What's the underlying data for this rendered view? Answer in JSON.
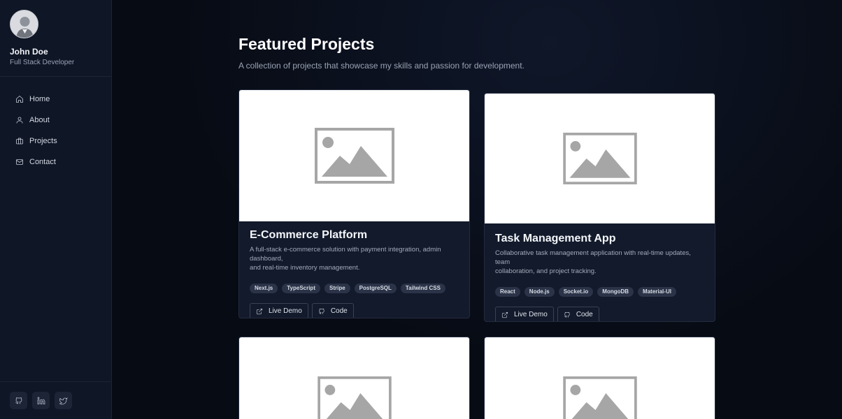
{
  "profile": {
    "name": "John Doe",
    "role": "Full Stack Developer"
  },
  "nav": [
    {
      "label": "Home",
      "icon": "home-icon"
    },
    {
      "label": "About",
      "icon": "user-icon"
    },
    {
      "label": "Projects",
      "icon": "briefcase-icon"
    },
    {
      "label": "Contact",
      "icon": "mail-icon"
    }
  ],
  "social": [
    "github-icon",
    "linkedin-icon",
    "twitter-icon"
  ],
  "main": {
    "title": "Featured Projects",
    "subtitle": "A collection of projects that showcase my skills and passion for development."
  },
  "projects": [
    {
      "title": "E-Commerce Platform",
      "desc_line1": "A full-stack e-commerce solution with payment integration, admin dashboard,",
      "desc_line2": "and real-time inventory management.",
      "tags": [
        "Next.js",
        "TypeScript",
        "Stripe",
        "PostgreSQL",
        "Tailwind CSS"
      ],
      "demo_label": "Live Demo",
      "code_label": "Code"
    },
    {
      "title": "Task Management App",
      "desc_line1": "Collaborative task management application with real-time updates, team",
      "desc_line2": "collaboration, and project tracking.",
      "tags": [
        "React",
        "Node.js",
        "Socket.io",
        "MongoDB",
        "Material-UI"
      ],
      "demo_label": "Live Demo",
      "code_label": "Code"
    }
  ]
}
